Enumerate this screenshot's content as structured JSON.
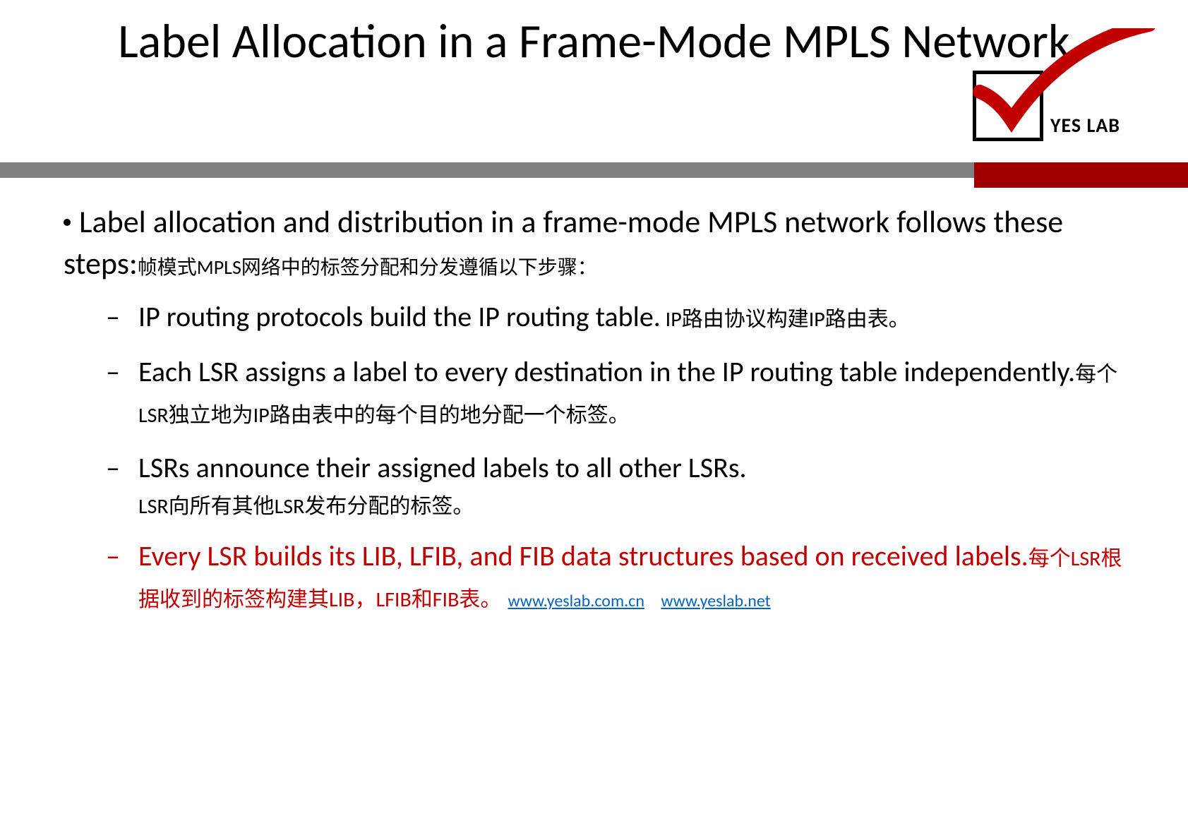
{
  "title": "Label Allocation in a Frame-Mode MPLS Network",
  "logo": {
    "text": "YES LAB"
  },
  "main_bullet": {
    "en": "Label allocation and distribution in a frame-mode MPLS network follows these steps:",
    "cn": "帧模式MPLS网络中的标签分配和分发遵循以下步骤："
  },
  "sub_items": [
    {
      "en": "IP routing protocols build the IP routing table.",
      "cn": " IP路由协议构建IP路由表。",
      "red": false
    },
    {
      "en": "Each LSR assigns a label to every destination in the  IP routing table independently.",
      "cn": "每个LSR独立地为IP路由表中的每个目的地分配一个标签。",
      "red": false
    },
    {
      "en": "LSRs announce their assigned labels to all other LSRs.",
      "cn": "LSR向所有其他LSR发布分配的标签。",
      "red": false,
      "cn_block": true
    },
    {
      "en": "Every LSR builds its LIB, LFIB, and FIB data structures based on received labels.",
      "cn": "每个LSR根据收到的标签构建其LIB，LFIB和FIB表。",
      "red": true
    }
  ],
  "links": [
    {
      "text": "www.yeslab.com.cn",
      "href": "#"
    },
    {
      "text": "www.yeslab.net",
      "href": "#"
    }
  ]
}
